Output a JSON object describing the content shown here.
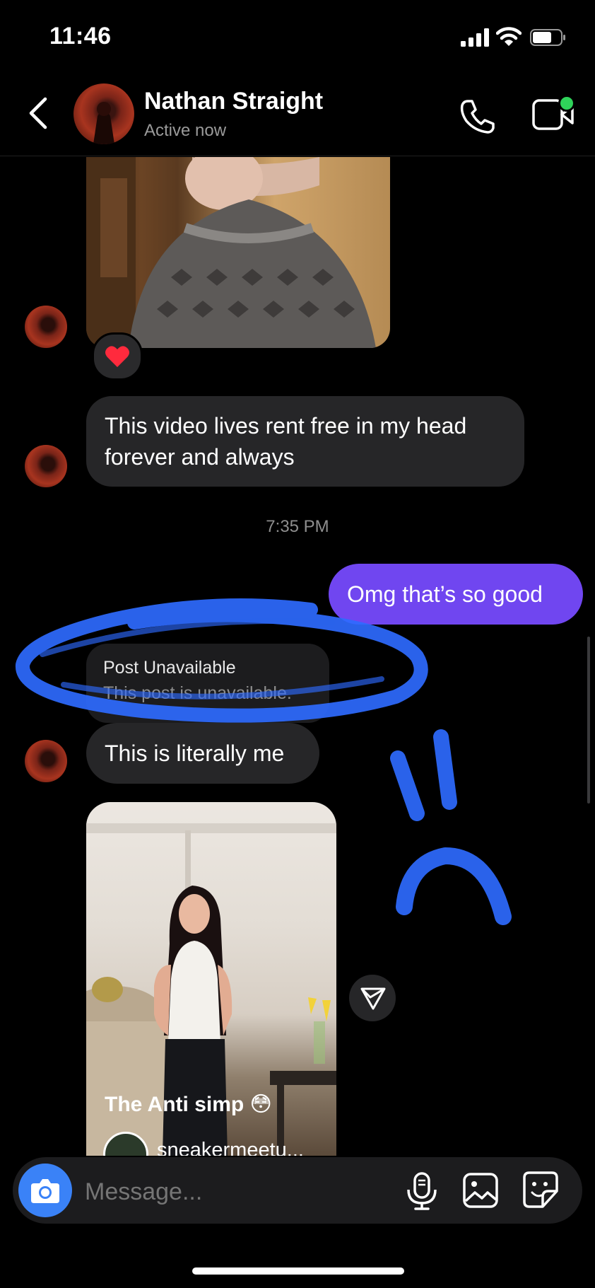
{
  "status_bar": {
    "time": "11:46"
  },
  "header": {
    "name": "Nathan Straight",
    "status": "Active now"
  },
  "messages": {
    "reaction": "❤️",
    "received_1": "This video lives rent free in my head forever and always",
    "timestamp": "7:35 PM",
    "sent_1": "Omg that’s so good",
    "post_unavailable_title": "Post Unavailable",
    "post_unavailable_sub": "This post is unavailable.",
    "received_2": "This is literally me",
    "reel_caption": "The Anti simp 😳",
    "reel_user": "sneakermeetu..."
  },
  "composer": {
    "placeholder": "Message..."
  },
  "colors": {
    "sent_bubble": "#7046f0",
    "received_bubble": "#262628",
    "camera_button": "#3a82f7",
    "annotation": "#2e6bff",
    "online_dot": "#2fd35a"
  }
}
